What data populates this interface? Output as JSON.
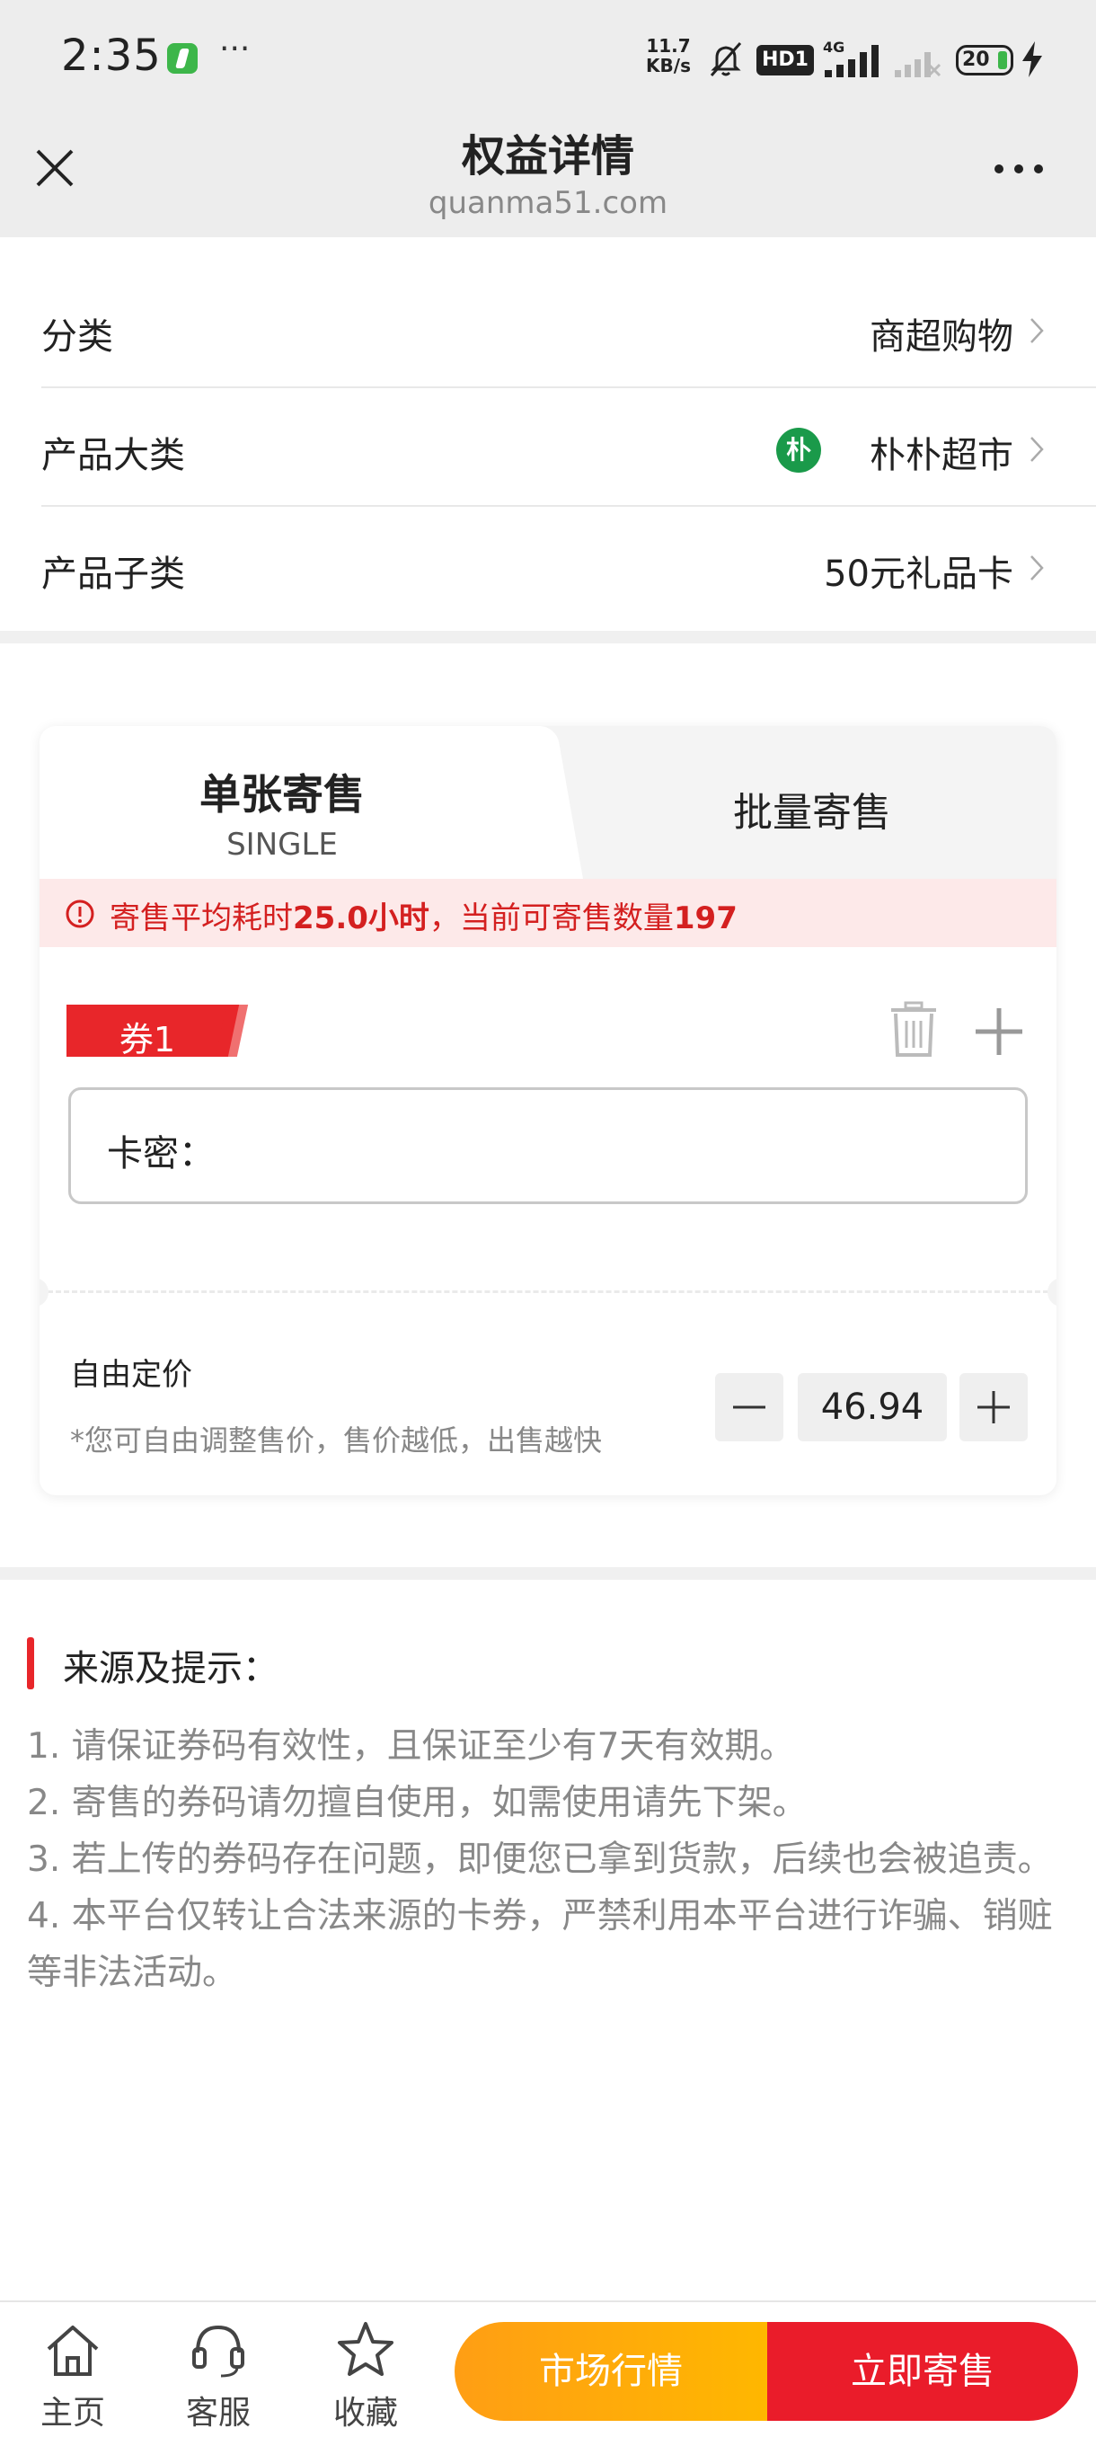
{
  "status_bar": {
    "time": "2:35",
    "more": "···",
    "speed_value": "11.7",
    "speed_unit": "KB/s",
    "hd_badge": "HD1",
    "network": "4G",
    "battery": "20"
  },
  "header": {
    "title": "权益详情",
    "subtitle": "quanma51.com"
  },
  "info_rows": [
    {
      "label": "分类",
      "value": "商超购物"
    },
    {
      "label": "产品大类",
      "value": "朴朴超市",
      "brand_char": "朴"
    },
    {
      "label": "产品子类",
      "value": "50元礼品卡"
    }
  ],
  "tabs": {
    "single_label": "单张寄售",
    "single_sub": "SINGLE",
    "batch_label": "批量寄售"
  },
  "notice": {
    "prefix": "寄售平均耗时",
    "hours": "25.0小时",
    "middle": "，当前可寄售数量",
    "count": "197"
  },
  "coupon": {
    "tag": "券1",
    "field_label": "卡密：",
    "field_placeholder": ""
  },
  "pricing": {
    "label": "自由定价",
    "hint": "*您可自由调整售价，售价越低，出售越快",
    "value": "46.94"
  },
  "tips": {
    "title": "来源及提示：",
    "items": [
      "1. 请保证券码有效性，且保证至少有7天有效期。",
      "2. 寄售的券码请勿擅自使用，如需使用请先下架。",
      "3. 若上传的券码存在问题，即便您已拿到货款，后续也会被追责。",
      "4. 本平台仅转让合法来源的卡券，严禁利用本平台进行诈骗、销赃等非法活动。"
    ]
  },
  "bottom_nav": {
    "home": "主页",
    "service": "客服",
    "favorite": "收藏",
    "market": "市场行情",
    "sell": "立即寄售"
  },
  "colors": {
    "accent_red": "#e8262a",
    "market_orange": "#ffa80a",
    "brand_green": "#1a9a4a",
    "notice_bg": "#fde9e9"
  },
  "icons": [
    "close-icon",
    "more-icon",
    "chevron-right-icon",
    "warning-icon",
    "trash-icon",
    "plus-icon",
    "minus-icon",
    "home-icon",
    "headset-icon",
    "star-icon"
  ]
}
